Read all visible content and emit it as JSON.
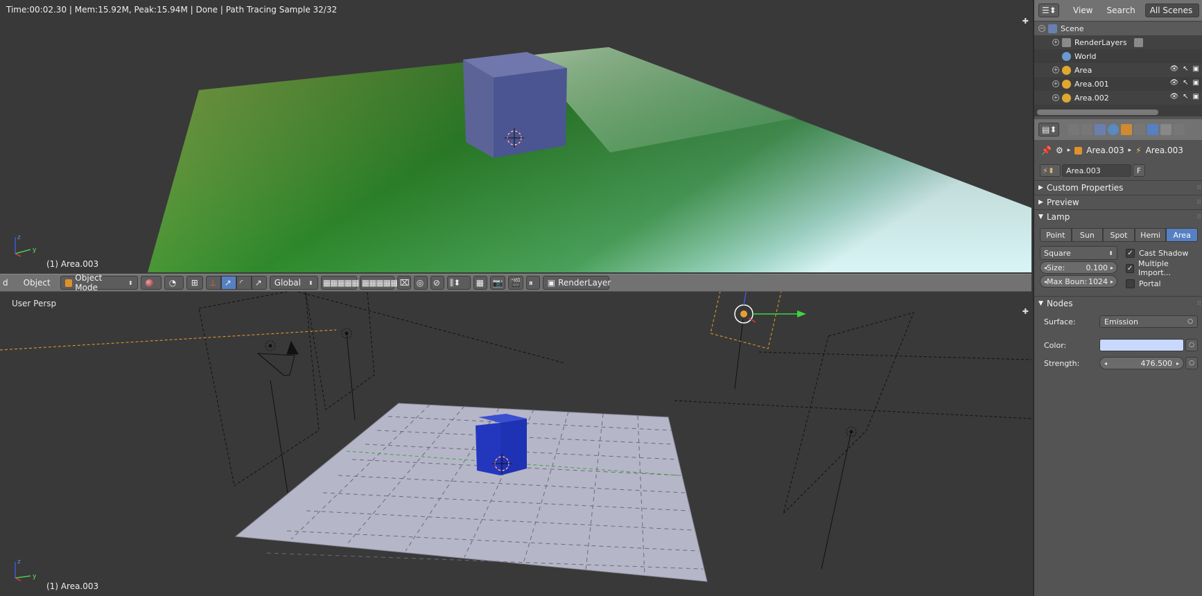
{
  "render": {
    "info": "Time:00:02.30 | Mem:15.92M, Peak:15.94M | Done | Path Tracing Sample 32/32",
    "object_label": "(1) Area.003"
  },
  "viewport_bottom": {
    "view_label": "User Persp",
    "object_label": "(1) Area.003"
  },
  "header": {
    "select_fragment": "d",
    "object_menu": "Object",
    "mode": "Object Mode",
    "orientation": "Global",
    "render_layer": "RenderLayer"
  },
  "outliner": {
    "view": "View",
    "search": "Search",
    "scenes": "All Scenes",
    "items": [
      {
        "label": "Scene"
      },
      {
        "label": "RenderLayers"
      },
      {
        "label": "World"
      },
      {
        "label": "Area"
      },
      {
        "label": "Area.001"
      },
      {
        "label": "Area.002"
      }
    ]
  },
  "properties": {
    "breadcrumb_object": "Area.003",
    "breadcrumb_data": "Area.003",
    "data_name": "Area.003",
    "fake_user": "F",
    "panels": {
      "custom_properties": "Custom Properties",
      "preview": "Preview",
      "lamp": "Lamp",
      "nodes": "Nodes"
    },
    "lamp_types": [
      "Point",
      "Sun",
      "Spot",
      "Hemi",
      "Area"
    ],
    "lamp_active": "Area",
    "shape": "Square",
    "size_label": "Size:",
    "size_value": "0.100",
    "max_bounces_label": "Max Boun:",
    "max_bounces_value": "1024",
    "cast_shadow": "Cast Shadow",
    "multiple_importance": "Multiple Import...",
    "portal": "Portal",
    "surface_label": "Surface:",
    "surface_value": "Emission",
    "color_label": "Color:",
    "color_value": "#c8d8ff",
    "strength_label": "Strength:",
    "strength_value": "476.500"
  },
  "colors": {
    "accent": "#5680c2",
    "ground_render": "#3f9a32",
    "cube_render": "#4a5591",
    "cube_solid": "#1e32b4",
    "plane_solid": "#b6b6c9"
  }
}
